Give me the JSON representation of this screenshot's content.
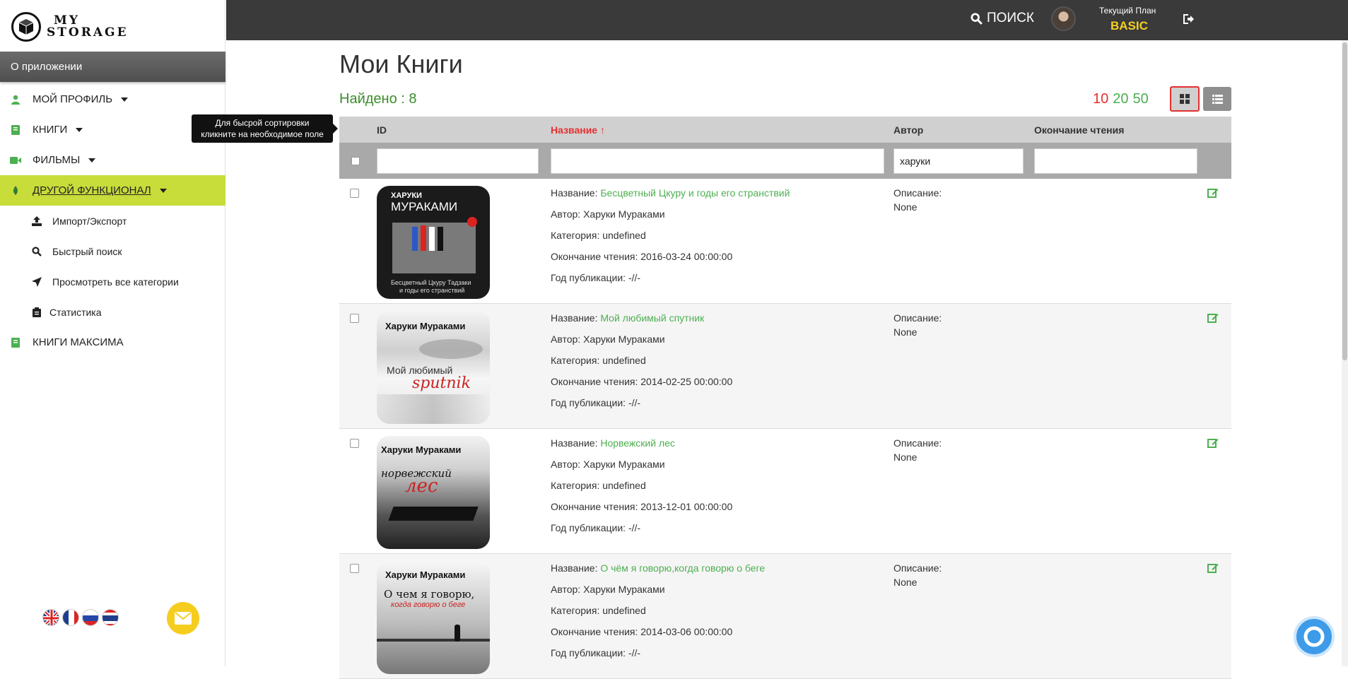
{
  "app": {
    "logo_text_1": "MY",
    "logo_text_2": "STORAGE"
  },
  "sidebar": {
    "about": "О приложении",
    "items": [
      {
        "label": "МОЙ ПРОФИЛЬ",
        "icon": "user-icon"
      },
      {
        "label": "КНИГИ",
        "icon": "book-icon"
      },
      {
        "label": "ФИЛЬМЫ",
        "icon": "video-icon"
      },
      {
        "label": "ДРУГОЙ ФУНКЦИОНАЛ",
        "icon": "leaf-icon"
      },
      {
        "label": "КНИГИ МАКСИМА",
        "icon": "book-icon"
      }
    ],
    "sub_items": [
      {
        "label": "Импорт/Экспорт",
        "icon": "upload-icon"
      },
      {
        "label": "Быстрый поиск",
        "icon": "search-icon"
      },
      {
        "label": "Просмотреть все категории",
        "icon": "send-icon"
      },
      {
        "label": "Статистика",
        "icon": "clipboard-icon"
      }
    ],
    "flags": [
      "uk-flag",
      "fr-flag",
      "ru-flag",
      "th-flag"
    ]
  },
  "tooltip": {
    "line1": "Для быcрой сортировки",
    "line2": "кликните на необходимое поле"
  },
  "topbar": {
    "search_label": "ПОИСК",
    "plan_label": "Текущий План",
    "plan_value": "BASIC"
  },
  "main": {
    "title": "Мои Книги",
    "found": "Найдено : 8",
    "per_page": [
      "10",
      "20",
      "50"
    ]
  },
  "table": {
    "columns": {
      "id": "ID",
      "name": "Название",
      "author": "Автор",
      "finished": "Окончание чтения"
    },
    "filters": {
      "id": "",
      "name": "",
      "author": "харуки",
      "finished": ""
    },
    "field_labels": {
      "name": "Название:",
      "author": "Автор:",
      "category": "Категория:",
      "finished": "Окончание чтения:",
      "year": "Год публикации:",
      "description": "Описание:"
    },
    "rows": [
      {
        "title": "Бесцветный Цкуру и годы его странствий",
        "author": "Харуки Мураками",
        "category": "undefined",
        "finished": "2016-03-24 00:00:00",
        "year": "-//-",
        "description": "None",
        "cover_line1": "ХАРУКИ",
        "cover_line2": "МУРАКАМИ",
        "cover_line3": "Бесцветный Цкуру Тадзаки",
        "cover_line4": "и годы его странствий"
      },
      {
        "title": "Мой любимый спутник",
        "author": "Харуки Мураками",
        "category": "undefined",
        "finished": "2014-02-25 00:00:00",
        "year": "-//-",
        "description": "None",
        "cover_line1": "Харуки Мураками",
        "cover_line2": "Мой любимый",
        "cover_line3": "sputnik"
      },
      {
        "title": "Норвежский лес",
        "author": "Харуки Мураками",
        "category": "undefined",
        "finished": "2013-12-01 00:00:00",
        "year": "-//-",
        "description": "None",
        "cover_line1": "Харуки Мураками",
        "cover_line2": "норвежский",
        "cover_line3": "лес"
      },
      {
        "title": "О чём я говорю,когда говорю о беге",
        "author": "Харуки Мураками",
        "category": "undefined",
        "finished": "2014-03-06 00:00:00",
        "year": "-//-",
        "description": "None",
        "cover_line1": "Харуки Мураками",
        "cover_line2": "О чем я говорю,",
        "cover_line3": "когда говорю о беге"
      }
    ]
  }
}
